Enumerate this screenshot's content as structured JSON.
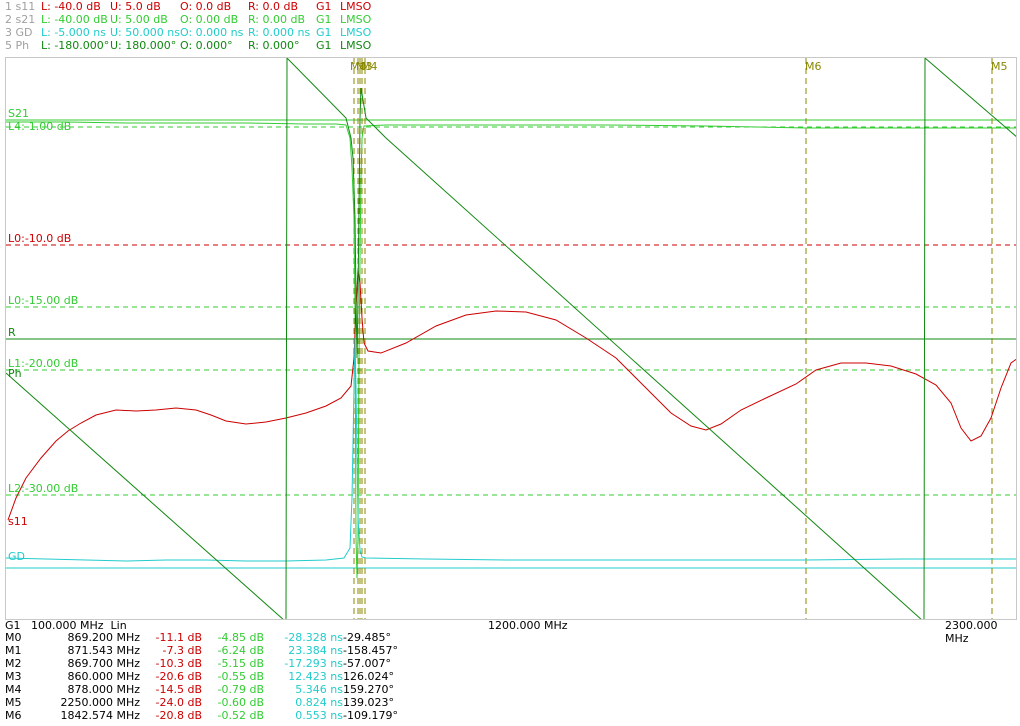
{
  "traces_header": [
    {
      "idx": "1 s11",
      "L": "L: -40.0 dB",
      "U": "U: 5.0 dB",
      "O": "O: 0.0 dB",
      "R": "R: 0.0 dB",
      "G": "G1",
      "mode": "LMSO",
      "color": "#cc0000",
      "dim": "#a0a0a0"
    },
    {
      "idx": "2 s21",
      "L": "L: -40.00 dB",
      "U": "U: 5.00 dB",
      "O": "O: 0.00 dB",
      "R": "R: 0.00 dB",
      "G": "G1",
      "mode": "LMSO",
      "color": "#33cc33",
      "dim": "#a0a0a0"
    },
    {
      "idx": "3 GD",
      "L": "L: -5.000 ns",
      "U": "U: 50.000 ns",
      "O": "O: 0.000 ns",
      "R": "R: 0.000 ns",
      "G": "G1",
      "mode": "LMSO",
      "color": "#22cccc",
      "dim": "#a0a0a0"
    },
    {
      "idx": "5 Ph",
      "L": "L: -180.000°",
      "U": "U: 180.000°",
      "O": "O: 0.000°",
      "R": "R: 0.000°",
      "G": "G1",
      "mode": "LMSO",
      "color": "#118811",
      "dim": "#a0a0a0"
    }
  ],
  "limits": [
    {
      "label": "L4:-1.00 dB",
      "color": "#33cc33"
    },
    {
      "label": "L0:-10.0 dB",
      "color": "#cc0000"
    },
    {
      "label": "L0:-15.00 dB",
      "color": "#33cc33"
    },
    {
      "label": "L1:-20.00 dB",
      "color": "#33cc33"
    },
    {
      "label": "L2:-30.00 dB",
      "color": "#33cc33"
    }
  ],
  "trace_tags": {
    "s21": "S21",
    "r": "R",
    "ph": "Ph",
    "s11": "s11",
    "gd": "GD"
  },
  "markers_top": {
    "m0": "M0",
    "m3": "M3",
    "m4": "M4",
    "m6": "M6",
    "m5": "M5"
  },
  "axis": {
    "start": "G1   100.000 MHz  Lin",
    "mid": "1200.000 MHz",
    "end": "2300.000 MHz"
  },
  "marker_table": [
    {
      "m": "M0",
      "f": "869.200 MHz",
      "s11": "-11.1 dB",
      "s21": "-4.85 dB",
      "gd": "-28.328 ns",
      "ph": "-29.485°"
    },
    {
      "m": "M1",
      "f": "871.543 MHz",
      "s11": "-7.3 dB",
      "s21": "-6.24 dB",
      "gd": "23.384 ns",
      "ph": "-158.457°"
    },
    {
      "m": "M2",
      "f": "869.700 MHz",
      "s11": "-10.3 dB",
      "s21": "-5.15 dB",
      "gd": "-17.293 ns",
      "ph": "-57.007°"
    },
    {
      "m": "M3",
      "f": "860.000 MHz",
      "s11": "-20.6 dB",
      "s21": "-0.55 dB",
      "gd": "12.423 ns",
      "ph": "126.024°"
    },
    {
      "m": "M4",
      "f": "878.000 MHz",
      "s11": "-14.5 dB",
      "s21": "-0.79 dB",
      "gd": "5.346 ns",
      "ph": "159.270°"
    },
    {
      "m": "M5",
      "f": "2250.000 MHz",
      "s11": "-24.0 dB",
      "s21": "-0.60 dB",
      "gd": "0.824 ns",
      "ph": "139.023°"
    },
    {
      "m": "M6",
      "f": "1842.574 MHz",
      "s11": "-20.8 dB",
      "s21": "-0.52 dB",
      "gd": "0.553 ns",
      "ph": "-109.179°"
    }
  ],
  "colors": {
    "s11": "#cc0000",
    "s21": "#33cc33",
    "gd": "#22cccc",
    "ph": "#118811",
    "marker": "#888800"
  }
}
